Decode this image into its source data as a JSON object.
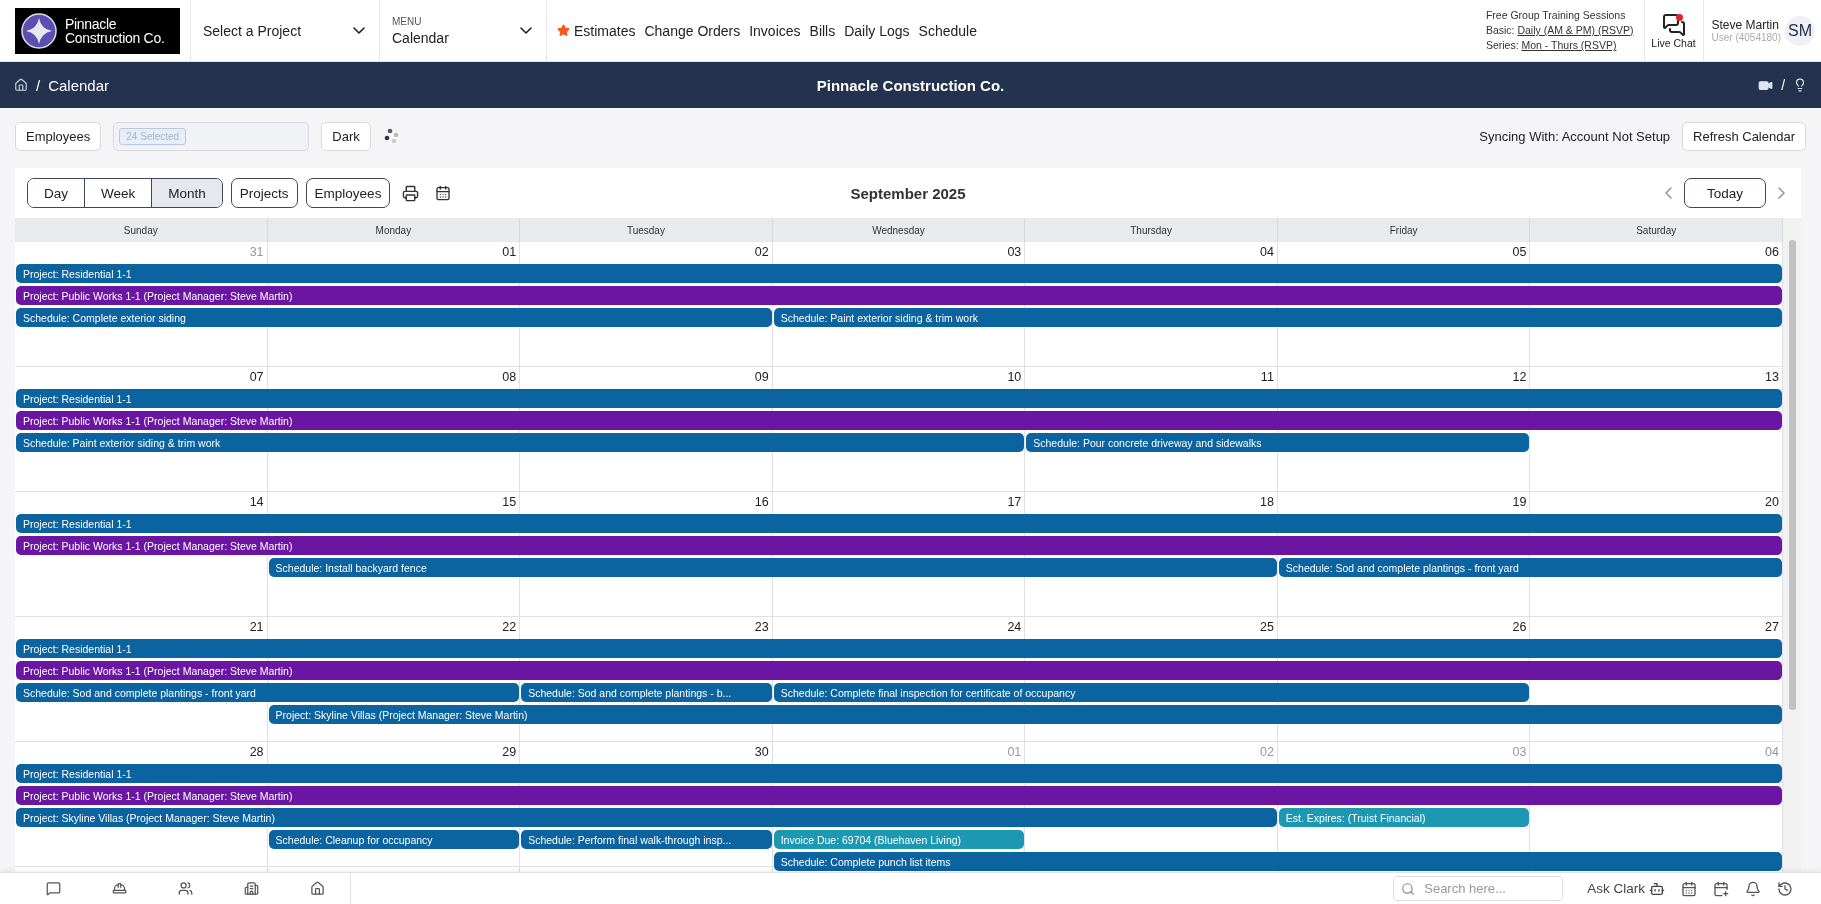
{
  "header": {
    "logo_lines": [
      "Pinnacle",
      "Construction Co."
    ],
    "project_select": {
      "value": "Select a Project"
    },
    "menu": {
      "label": "MENU",
      "value": "Calendar"
    },
    "nav_links": [
      {
        "label": "Estimates",
        "starred": true
      },
      {
        "label": "Change Orders",
        "starred": false
      },
      {
        "label": "Invoices",
        "starred": false
      },
      {
        "label": "Bills",
        "starred": false
      },
      {
        "label": "Daily Logs",
        "starred": false
      },
      {
        "label": "Schedule",
        "starred": false
      }
    ],
    "training": {
      "title": "Free Group Training Sessions",
      "lines": [
        {
          "label": "Basic:",
          "link": "Daily (AM & PM) (RSVP)"
        },
        {
          "label": "Series:",
          "link": "Mon - Thurs (RSVP)"
        }
      ]
    },
    "live_chat": {
      "label": "Live Chat",
      "unread": true
    },
    "user": {
      "name": "Steve Martin",
      "role": "User (4054180)",
      "initials": "SM"
    }
  },
  "navbar": {
    "breadcrumb_separator": "/",
    "breadcrumb": "Calendar",
    "title": "Pinnacle Construction Co.",
    "tools_separator": "/"
  },
  "toolbar": {
    "employees_button": "Employees",
    "selected_chip": "24 Selected",
    "dark_button": "Dark",
    "sync_status": "Syncing With: Account Not Setup",
    "refresh_button": "Refresh Calendar"
  },
  "calendar": {
    "views": [
      {
        "label": "Day",
        "selected": false
      },
      {
        "label": "Week",
        "selected": false
      },
      {
        "label": "Month",
        "selected": true
      }
    ],
    "filters": [
      "Projects",
      "Employees"
    ],
    "month_title": "September 2025",
    "today_button": "Today",
    "weekdays": [
      "Sunday",
      "Monday",
      "Tuesday",
      "Wednesday",
      "Thursday",
      "Friday",
      "Saturday"
    ],
    "weeks": [
      {
        "days": [
          {
            "label": "31",
            "in_month": false
          },
          {
            "label": "01",
            "in_month": true
          },
          {
            "label": "02",
            "in_month": true
          },
          {
            "label": "03",
            "in_month": true
          },
          {
            "label": "04",
            "in_month": true
          },
          {
            "label": "05",
            "in_month": true
          },
          {
            "label": "06",
            "in_month": true
          }
        ],
        "lanes": [
          [
            {
              "kind": "event",
              "text": "Project: Residential 1-1",
              "color": "#0b63a0"
            },
            {
              "kind": "continued"
            },
            {
              "kind": "continued"
            },
            {
              "kind": "continued"
            },
            {
              "kind": "continued"
            },
            {
              "kind": "continued"
            },
            {
              "kind": "continued"
            }
          ],
          [
            {
              "kind": "event",
              "text": "Project: Public Works 1-1 (Project Manager: Steve Martin)",
              "color": "#6a16a3"
            },
            {
              "kind": "continued"
            },
            {
              "kind": "continued"
            },
            {
              "kind": "continued"
            },
            {
              "kind": "continued"
            },
            {
              "kind": "continued"
            },
            {
              "kind": "continued"
            }
          ],
          [
            {
              "kind": "event",
              "text": "Schedule: Complete exterior siding",
              "color": "#0b63a0"
            },
            {
              "kind": "continued"
            },
            {
              "kind": "continued"
            },
            {
              "kind": "event",
              "text": "Schedule: Paint exterior siding & trim work",
              "color": "#0b63a0"
            },
            {
              "kind": "continued"
            },
            {
              "kind": "continued"
            },
            {
              "kind": "continued"
            }
          ]
        ]
      },
      {
        "days": [
          {
            "label": "07",
            "in_month": true
          },
          {
            "label": "08",
            "in_month": true
          },
          {
            "label": "09",
            "in_month": true
          },
          {
            "label": "10",
            "in_month": true
          },
          {
            "label": "11",
            "in_month": true
          },
          {
            "label": "12",
            "in_month": true
          },
          {
            "label": "13",
            "in_month": true
          }
        ],
        "lanes": [
          [
            {
              "kind": "event",
              "text": "Project: Residential 1-1",
              "color": "#0b63a0"
            },
            {
              "kind": "continued"
            },
            {
              "kind": "continued"
            },
            {
              "kind": "continued"
            },
            {
              "kind": "continued"
            },
            {
              "kind": "continued"
            },
            {
              "kind": "continued"
            }
          ],
          [
            {
              "kind": "event",
              "text": "Project: Public Works 1-1 (Project Manager: Steve Martin)",
              "color": "#6a16a3"
            },
            {
              "kind": "continued"
            },
            {
              "kind": "continued"
            },
            {
              "kind": "continued"
            },
            {
              "kind": "continued"
            },
            {
              "kind": "continued"
            },
            {
              "kind": "continued"
            }
          ],
          [
            {
              "kind": "event",
              "text": "Schedule: Paint exterior siding & trim work",
              "color": "#0b63a0"
            },
            {
              "kind": "continued"
            },
            {
              "kind": "continued"
            },
            {
              "kind": "continued"
            },
            {
              "kind": "event",
              "text": "Schedule: Pour concrete driveway and sidewalks",
              "color": "#0b63a0"
            },
            {
              "kind": "continued"
            },
            {
              "kind": "empty"
            }
          ]
        ]
      },
      {
        "days": [
          {
            "label": "14",
            "in_month": true
          },
          {
            "label": "15",
            "in_month": true
          },
          {
            "label": "16",
            "in_month": true
          },
          {
            "label": "17",
            "in_month": true
          },
          {
            "label": "18",
            "in_month": true
          },
          {
            "label": "19",
            "in_month": true
          },
          {
            "label": "20",
            "in_month": true
          }
        ],
        "lanes": [
          [
            {
              "kind": "event",
              "text": "Project: Residential 1-1",
              "color": "#0b63a0"
            },
            {
              "kind": "continued"
            },
            {
              "kind": "continued"
            },
            {
              "kind": "continued"
            },
            {
              "kind": "continued"
            },
            {
              "kind": "continued"
            },
            {
              "kind": "continued"
            }
          ],
          [
            {
              "kind": "event",
              "text": "Project: Public Works 1-1 (Project Manager: Steve Martin)",
              "color": "#6a16a3"
            },
            {
              "kind": "continued"
            },
            {
              "kind": "continued"
            },
            {
              "kind": "continued"
            },
            {
              "kind": "continued"
            },
            {
              "kind": "continued"
            },
            {
              "kind": "continued"
            }
          ],
          [
            {
              "kind": "empty"
            },
            {
              "kind": "event",
              "text": "Schedule: Install backyard fence",
              "color": "#0b63a0"
            },
            {
              "kind": "continued"
            },
            {
              "kind": "continued"
            },
            {
              "kind": "continued"
            },
            {
              "kind": "event",
              "text": "Schedule: Sod and complete plantings - front yard",
              "color": "#0b63a0"
            },
            {
              "kind": "continued"
            }
          ]
        ]
      },
      {
        "days": [
          {
            "label": "21",
            "in_month": true
          },
          {
            "label": "22",
            "in_month": true
          },
          {
            "label": "23",
            "in_month": true
          },
          {
            "label": "24",
            "in_month": true
          },
          {
            "label": "25",
            "in_month": true
          },
          {
            "label": "26",
            "in_month": true
          },
          {
            "label": "27",
            "in_month": true
          }
        ],
        "lanes": [
          [
            {
              "kind": "event",
              "text": "Project: Residential 1-1",
              "color": "#0b63a0"
            },
            {
              "kind": "continued"
            },
            {
              "kind": "continued"
            },
            {
              "kind": "continued"
            },
            {
              "kind": "continued"
            },
            {
              "kind": "continued"
            },
            {
              "kind": "continued"
            }
          ],
          [
            {
              "kind": "event",
              "text": "Project: Public Works 1-1 (Project Manager: Steve Martin)",
              "color": "#6a16a3"
            },
            {
              "kind": "continued"
            },
            {
              "kind": "continued"
            },
            {
              "kind": "continued"
            },
            {
              "kind": "continued"
            },
            {
              "kind": "continued"
            },
            {
              "kind": "continued"
            }
          ],
          [
            {
              "kind": "event",
              "text": "Schedule: Sod and complete plantings - front yard",
              "color": "#0b63a0"
            },
            {
              "kind": "continued"
            },
            {
              "kind": "event",
              "text": "Schedule: Sod and complete plantings - b...",
              "color": "#0b63a0"
            },
            {
              "kind": "event",
              "text": "Schedule: Complete final inspection for certificate of occupancy",
              "color": "#0b63a0"
            },
            {
              "kind": "continued"
            },
            {
              "kind": "continued"
            },
            {
              "kind": "empty"
            }
          ],
          [
            {
              "kind": "empty"
            },
            {
              "kind": "event",
              "text": "Project: Skyline Villas (Project Manager: Steve Martin)",
              "color": "#0b63a0"
            },
            {
              "kind": "continued"
            },
            {
              "kind": "continued"
            },
            {
              "kind": "continued"
            },
            {
              "kind": "continued"
            },
            {
              "kind": "continued"
            }
          ]
        ]
      },
      {
        "days": [
          {
            "label": "28",
            "in_month": true
          },
          {
            "label": "29",
            "in_month": true
          },
          {
            "label": "30",
            "in_month": true
          },
          {
            "label": "01",
            "in_month": false
          },
          {
            "label": "02",
            "in_month": false
          },
          {
            "label": "03",
            "in_month": false
          },
          {
            "label": "04",
            "in_month": false
          }
        ],
        "lanes": [
          [
            {
              "kind": "event",
              "text": "Project: Residential 1-1",
              "color": "#0b63a0"
            },
            {
              "kind": "continued"
            },
            {
              "kind": "continued"
            },
            {
              "kind": "continued"
            },
            {
              "kind": "continued"
            },
            {
              "kind": "continued"
            },
            {
              "kind": "continued"
            }
          ],
          [
            {
              "kind": "event",
              "text": "Project: Public Works 1-1 (Project Manager: Steve Martin)",
              "color": "#6a16a3"
            },
            {
              "kind": "continued"
            },
            {
              "kind": "continued"
            },
            {
              "kind": "continued"
            },
            {
              "kind": "continued"
            },
            {
              "kind": "continued"
            },
            {
              "kind": "continued"
            }
          ],
          [
            {
              "kind": "event",
              "text": "Project: Skyline Villas (Project Manager: Steve Martin)",
              "color": "#0b63a0"
            },
            {
              "kind": "continued"
            },
            {
              "kind": "continued"
            },
            {
              "kind": "continued"
            },
            {
              "kind": "continued"
            },
            {
              "kind": "event",
              "text": "Est. Expires: (Truist Financial)",
              "color": "#1c98b3"
            },
            {
              "kind": "empty"
            }
          ],
          [
            {
              "kind": "empty"
            },
            {
              "kind": "event",
              "text": "Schedule: Cleanup for occupancy",
              "color": "#0b63a0"
            },
            {
              "kind": "event",
              "text": "Schedule: Perform final walk-through insp...",
              "color": "#0b63a0"
            },
            {
              "kind": "event",
              "text": "Invoice Due: 69704 (Bluehaven Living)",
              "color": "#1c98b3"
            },
            {
              "kind": "empty"
            },
            {
              "kind": "empty"
            },
            {
              "kind": "empty"
            }
          ],
          [
            {
              "kind": "empty"
            },
            {
              "kind": "empty"
            },
            {
              "kind": "empty"
            },
            {
              "kind": "event",
              "text": "Schedule: Complete punch list items",
              "color": "#0b63a0"
            },
            {
              "kind": "continued"
            },
            {
              "kind": "continued"
            },
            {
              "kind": "continued"
            }
          ]
        ]
      }
    ]
  },
  "footer": {
    "search": {
      "placeholder": "Search here..."
    },
    "assistant": "Ask Clark"
  }
}
